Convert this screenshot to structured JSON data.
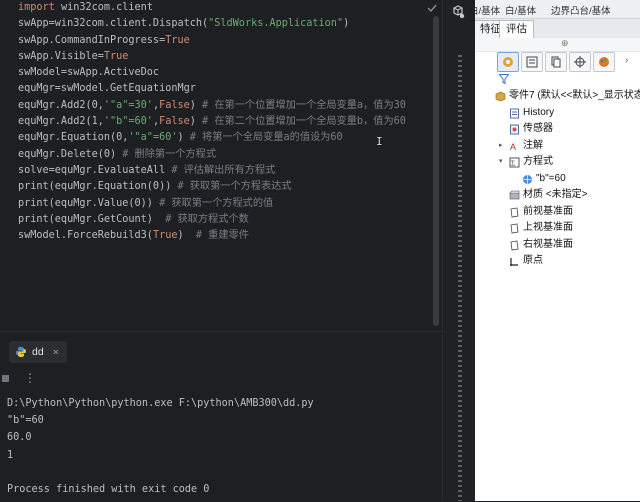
{
  "editor": {
    "lines": [
      [
        {
          "t": "import",
          "c": "kw"
        },
        {
          "t": " win32com.client"
        }
      ],
      [
        {
          "t": "swApp=win32com.client.Dispatch("
        },
        {
          "t": "\"SldWorks.Application\"",
          "c": "str"
        },
        {
          "t": ")"
        }
      ],
      [
        {
          "t": "swApp.CommandInProgress="
        },
        {
          "t": "True",
          "c": "cn"
        }
      ],
      [
        {
          "t": "swApp.Visible="
        },
        {
          "t": "True",
          "c": "cn"
        }
      ],
      [
        {
          "t": "swModel=swApp.ActiveDoc"
        }
      ],
      [
        {
          "t": "equMgr=swModel.GetEquationMgr"
        }
      ],
      [
        {
          "t": "equMgr.Add2(0,"
        },
        {
          "t": "'\"a\"=30'",
          "c": "str"
        },
        {
          "t": ","
        },
        {
          "t": "False",
          "c": "cn"
        },
        {
          "t": ") "
        },
        {
          "t": "# 在第一个位置增加一个全局变量a，值为30",
          "c": "cm"
        }
      ],
      [
        {
          "t": "equMgr.Add2(1,"
        },
        {
          "t": "'\"b\"=60'",
          "c": "str"
        },
        {
          "t": ","
        },
        {
          "t": "False",
          "c": "cn"
        },
        {
          "t": ") "
        },
        {
          "t": "# 在第二个位置增加一个全局变量b，值为60",
          "c": "cm"
        }
      ],
      [
        {
          "t": "equMgr.Equation(0,"
        },
        {
          "t": "'\"a\"=60'",
          "c": "str"
        },
        {
          "t": ") "
        },
        {
          "t": "# 将第一个全局变量a的值设为60",
          "c": "cm"
        }
      ],
      [
        {
          "t": "equMgr.Delete(0) "
        },
        {
          "t": "# 删除第一个方程式",
          "c": "cm"
        }
      ],
      [
        {
          "t": "solve=equMgr.EvaluateAll "
        },
        {
          "t": "# 评估解出所有方程式",
          "c": "cm"
        }
      ],
      [
        {
          "t": "print(equMgr.Equation(0)) "
        },
        {
          "t": "# 获取第一个方程表达式",
          "c": "cm"
        }
      ],
      [
        {
          "t": "print(equMgr.Value(0)) "
        },
        {
          "t": "# 获取第一个方程式的值",
          "c": "cm"
        }
      ],
      [
        {
          "t": "print(equMgr.GetCount)  "
        },
        {
          "t": "# 获取方程式个数",
          "c": "cm"
        }
      ],
      [
        {
          "t": "swModel.ForceRebuild3("
        },
        {
          "t": "True",
          "c": "cn"
        },
        {
          "t": ")  "
        },
        {
          "t": "# 重建零件",
          "c": "cm"
        }
      ]
    ],
    "colors": {
      "background": "#1e1f22",
      "text": "#bcbec4",
      "keyword": "#cf8e6d",
      "string": "#6aab73",
      "comment": "#7a7e85"
    }
  },
  "run_panel": {
    "tab_label": "dd",
    "tab_close": "×",
    "more_icon": "⋮",
    "console": [
      "D:\\Python\\Python\\python.exe F:\\python\\AMB300\\dd.py",
      "\"b\"=60",
      "60.0",
      "1",
      "",
      "Process finished with exit code 0"
    ]
  },
  "sw": {
    "top_tabs": [
      "白/基体",
      "白/基体",
      "边界凸台/基体"
    ],
    "tabs": {
      "feature": "特征",
      "evaluate": "评估"
    },
    "icons": [
      "feature-manager-icon",
      "property-manager-icon",
      "configuration-manager-icon",
      "dimxpert-icon",
      "display-manager-icon"
    ],
    "tree": [
      {
        "label": "零件7 (默认<<默认>_显示状态",
        "icon": "part-icon",
        "arrow": "",
        "indent": 0
      },
      {
        "label": "History",
        "icon": "history-icon",
        "arrow": "",
        "indent": 1
      },
      {
        "label": "传感器",
        "icon": "sensor-icon",
        "arrow": "",
        "indent": 1
      },
      {
        "label": "注解",
        "icon": "annotation-icon",
        "arrow": "▸",
        "indent": 1
      },
      {
        "label": "方程式",
        "icon": "equation-icon",
        "arrow": "▾",
        "indent": 1
      },
      {
        "label": "\"b\"=60",
        "icon": "global-variable-icon",
        "arrow": "",
        "indent": 2
      },
      {
        "label": "材质 <未指定>",
        "icon": "material-icon",
        "arrow": "",
        "indent": 1
      },
      {
        "label": "前视基准面",
        "icon": "plane-icon",
        "arrow": "",
        "indent": 1
      },
      {
        "label": "上视基准面",
        "icon": "plane-icon",
        "arrow": "",
        "indent": 1
      },
      {
        "label": "右视基准面",
        "icon": "plane-icon",
        "arrow": "",
        "indent": 1
      },
      {
        "label": "原点",
        "icon": "origin-icon",
        "arrow": "",
        "indent": 1
      }
    ]
  }
}
